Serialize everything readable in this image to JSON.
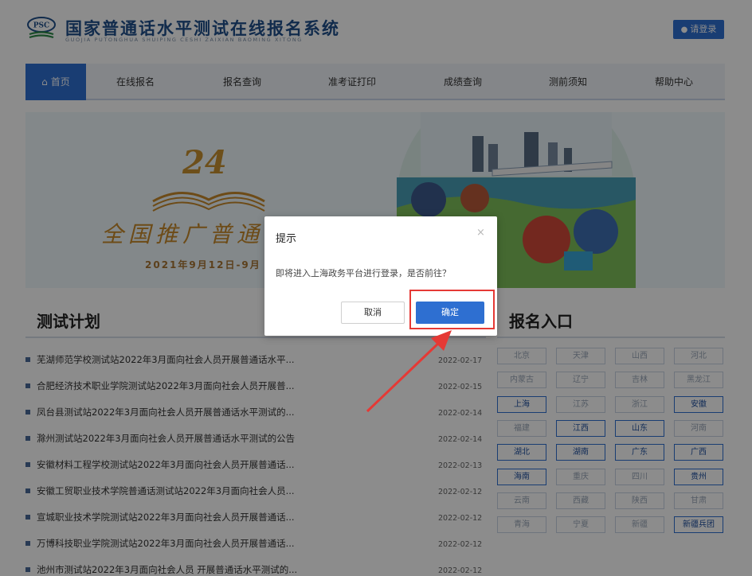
{
  "header": {
    "logo_badge": "PSC",
    "title": "国家普通话水平测试在线报名系统",
    "subtitle": "GUOJIA PUTONGHUA SHUIPING CESHI ZAIXIAN BAOMING XITONG",
    "login_label": "请登录"
  },
  "nav": {
    "items": [
      "首页",
      "在线报名",
      "报名查询",
      "准考证打印",
      "成绩查询",
      "测前须知",
      "帮助中心"
    ]
  },
  "banner": {
    "number": "24",
    "slogan": "全国推广普通话",
    "date": "2021年9月12日-9月"
  },
  "sections": {
    "plan_title": "测试计划",
    "signup_title": "报名入口"
  },
  "news": [
    {
      "title": "芜湖师范学校测试站2022年3月面向社会人员开展普通话水平...",
      "date": "2022-02-17"
    },
    {
      "title": "合肥经济技术职业学院测试站2022年3月面向社会人员开展普...",
      "date": "2022-02-15"
    },
    {
      "title": "凤台县测试站2022年3月面向社会人员开展普通话水平测试的...",
      "date": "2022-02-14"
    },
    {
      "title": "滁州测试站2022年3月面向社会人员开展普通话水平测试的公告",
      "date": "2022-02-14"
    },
    {
      "title": "安徽材料工程学校测试站2022年3月面向社会人员开展普通话...",
      "date": "2022-02-13"
    },
    {
      "title": "安徽工贸职业技术学院普通话测试站2022年3月面向社会人员...",
      "date": "2022-02-12"
    },
    {
      "title": "宣城职业技术学院测试站2022年3月面向社会人员开展普通话...",
      "date": "2022-02-12"
    },
    {
      "title": "万博科技职业学院测试站2022年3月面向社会人员开展普通话...",
      "date": "2022-02-12"
    },
    {
      "title": "池州市测试站2022年3月面向社会人员 开展普通话水平测试的...",
      "date": "2022-02-12"
    }
  ],
  "provinces": [
    {
      "name": "北京",
      "active": false
    },
    {
      "name": "天津",
      "active": false
    },
    {
      "name": "山西",
      "active": false
    },
    {
      "name": "河北",
      "active": false
    },
    {
      "name": "内蒙古",
      "active": false
    },
    {
      "name": "辽宁",
      "active": false
    },
    {
      "name": "吉林",
      "active": false
    },
    {
      "name": "黑龙江",
      "active": false
    },
    {
      "name": "上海",
      "active": true
    },
    {
      "name": "江苏",
      "active": false
    },
    {
      "name": "浙江",
      "active": false
    },
    {
      "name": "安徽",
      "active": true
    },
    {
      "name": "福建",
      "active": false
    },
    {
      "name": "江西",
      "active": true
    },
    {
      "name": "山东",
      "active": true
    },
    {
      "name": "河南",
      "active": false
    },
    {
      "name": "湖北",
      "active": true
    },
    {
      "name": "湖南",
      "active": true
    },
    {
      "name": "广东",
      "active": true
    },
    {
      "name": "广西",
      "active": true
    },
    {
      "name": "海南",
      "active": true
    },
    {
      "name": "重庆",
      "active": false
    },
    {
      "name": "四川",
      "active": false
    },
    {
      "name": "贵州",
      "active": true
    },
    {
      "name": "云南",
      "active": false
    },
    {
      "name": "西藏",
      "active": false
    },
    {
      "name": "陕西",
      "active": false
    },
    {
      "name": "甘肃",
      "active": false
    },
    {
      "name": "青海",
      "active": false
    },
    {
      "name": "宁夏",
      "active": false
    },
    {
      "name": "新疆",
      "active": false
    },
    {
      "name": "新疆兵团",
      "active": true
    }
  ],
  "dialog": {
    "title": "提示",
    "close_glyph": "×",
    "message": "即将进入上海政务平台进行登录，是否前往？",
    "cancel_label": "取消",
    "confirm_label": "确定"
  },
  "colors": {
    "primary": "#2e6fd1",
    "brand_text": "#1f4f8a",
    "annotation": "#e53935"
  },
  "icons": {
    "user": "user-icon",
    "home": "home-icon",
    "close": "close-icon",
    "bullet": "square-bullet-icon"
  }
}
